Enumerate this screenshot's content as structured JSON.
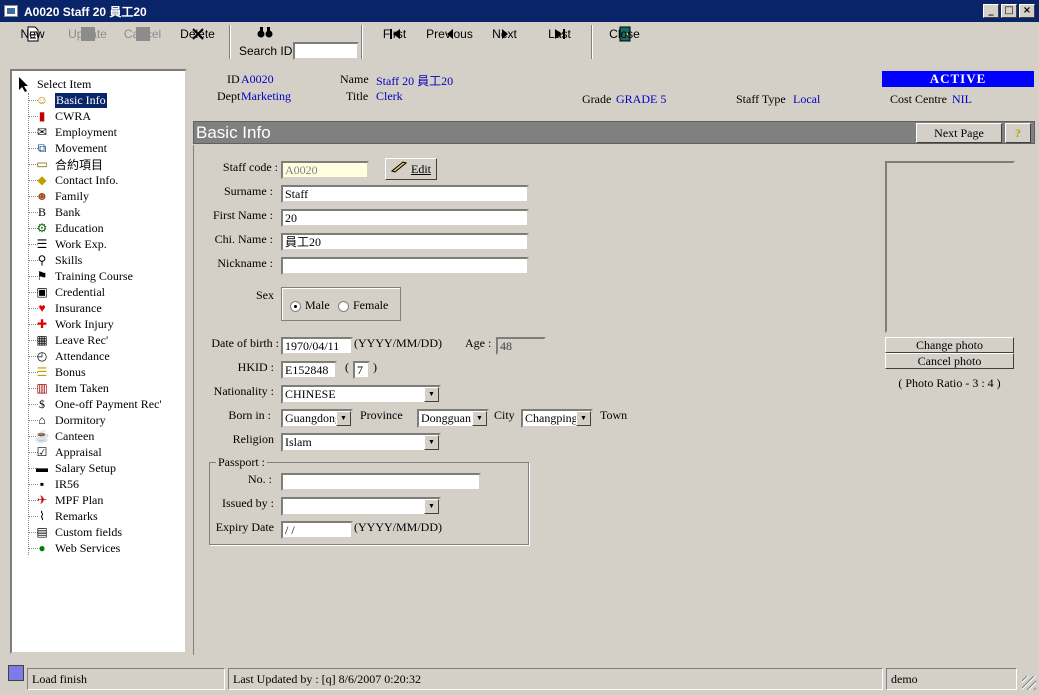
{
  "window": {
    "title": "A0020 Staff 20 員工20",
    "btns": [
      "_",
      "□",
      "×"
    ]
  },
  "toolbar": {
    "new": "New",
    "update": "Update",
    "cancel": "Cancel",
    "delete": "Delete",
    "search_id": "Search ID",
    "first": "First",
    "previous": "Previous",
    "next": "Next",
    "last": "Last",
    "close": "Close"
  },
  "tree": {
    "root": "Select Item",
    "items": [
      "Basic Info",
      "CWRA",
      "Employment",
      "Movement",
      "合約項目",
      "Contact Info.",
      "Family",
      "Bank",
      "Education",
      "Work Exp.",
      "Skills",
      "Training Course",
      "Credential",
      "Insurance",
      "Work Injury",
      "Leave Rec'",
      "Attendance",
      "Bonus",
      "Item Taken",
      "One-off Payment Rec'",
      "Dormitory",
      "Canteen",
      "Appraisal",
      "Salary Setup",
      "IR56",
      "MPF Plan",
      "Remarks",
      "Custom fields",
      "Web Services"
    ]
  },
  "header": {
    "id_label": "ID",
    "id": "A0020",
    "name_label": "Name",
    "name": "Staff 20 員工20",
    "dept_label": "Dept",
    "dept": "Marketing",
    "title_label": "Title",
    "title": "Clerk",
    "grade_label": "Grade",
    "grade": "GRADE 5",
    "staff_type_label": "Staff Type",
    "staff_type": "Local",
    "cost_centre_label": "Cost Centre",
    "cost_centre": "NIL",
    "status": "ACTIVE"
  },
  "section": {
    "title": "Basic Info",
    "next_page": "Next Page",
    "help": "?"
  },
  "form": {
    "staff_code_label": "Staff code :",
    "staff_code": "A0020",
    "edit": "Edit",
    "surname_label": "Surname :",
    "surname": "Staff",
    "first_name_label": "First Name :",
    "first_name": "20",
    "chi_name_label": "Chi. Name :",
    "chi_name": "員工20",
    "nickname_label": "Nickname :",
    "nickname": "",
    "sex_label": "Sex",
    "male": "Male",
    "female": "Female",
    "dob_label": "Date of birth :",
    "dob": "1970/04/11",
    "date_fmt": "(YYYY/MM/DD)",
    "age_label": "Age :",
    "age": "48",
    "hkid_label": "HKID :",
    "hkid": "E152848",
    "hkid_paren_open": "(",
    "hkid_check": "7",
    "hkid_paren_close": ")",
    "nationality_label": "Nationality :",
    "nationality": "CHINESE",
    "born_label": "Born in :",
    "province_val": "Guangdong",
    "province_label": "Province",
    "city_val": "Dongguan",
    "city_label": "City",
    "town_val": "Changping",
    "town_label": "Town",
    "religion_label": "Religion",
    "religion": "Islam",
    "passport_legend": "Passport :",
    "passport_no_label": "No. :",
    "passport_no": "",
    "issued_label": "Issued by :",
    "issued": "",
    "expiry_label": "Expiry Date",
    "expiry": " / /",
    "expiry_fmt": "(YYYY/MM/DD)"
  },
  "photo": {
    "change": "Change photo",
    "cancel": "Cancel photo",
    "ratio": "( Photo Ratio - 3 : 4 )"
  },
  "status": {
    "left": "Load finish",
    "updated": "Last Updated by : [q]  8/6/2007 0:20:32",
    "user": "demo"
  }
}
